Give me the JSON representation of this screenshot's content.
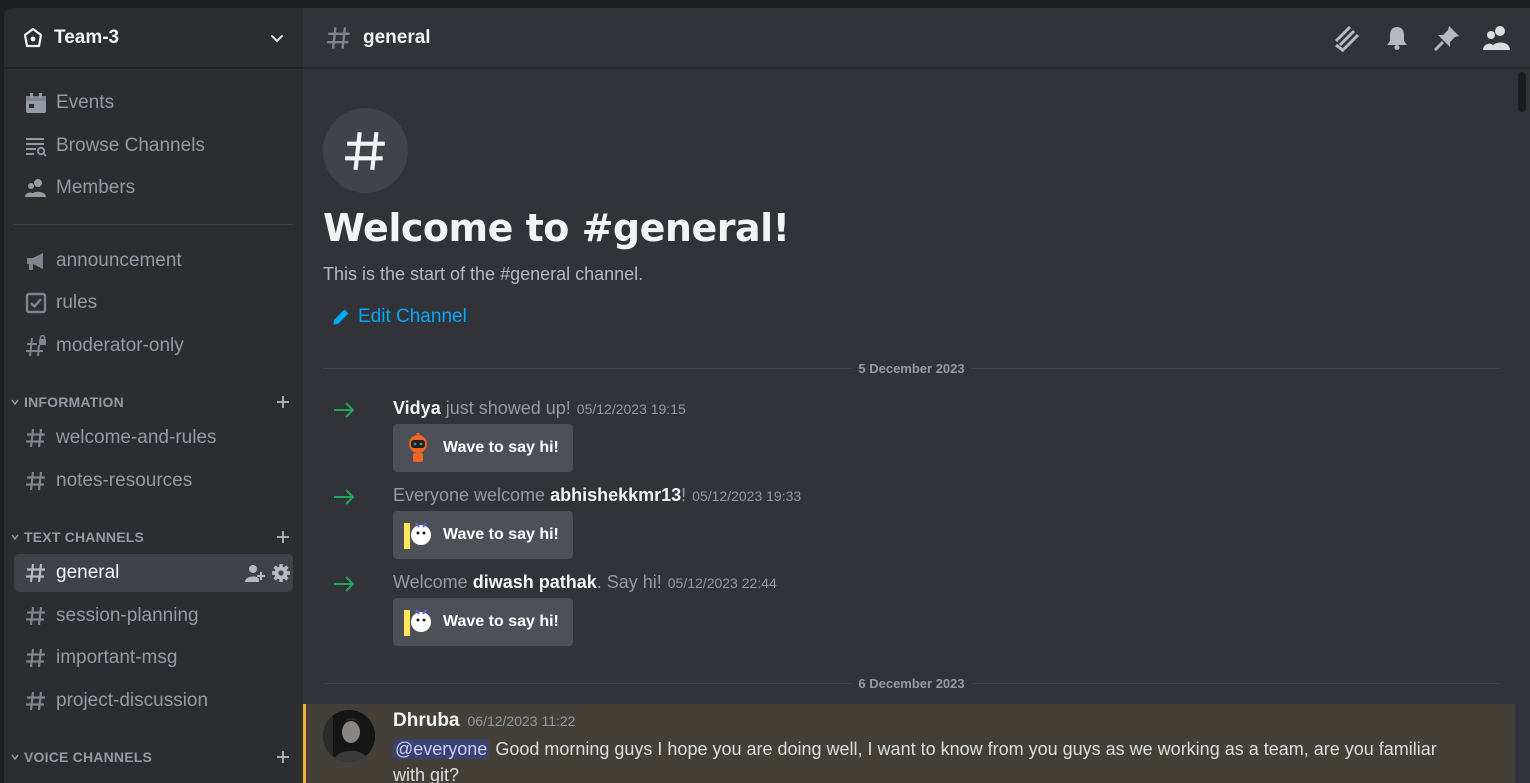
{
  "server": {
    "name": "Team-3",
    "icon": "server-home-icon"
  },
  "nav": [
    {
      "label": "Events",
      "icon": "calendar-icon"
    },
    {
      "label": "Browse Channels",
      "icon": "browse-channels-icon"
    },
    {
      "label": "Members",
      "icon": "members-icon"
    }
  ],
  "top_channels": [
    {
      "label": "announcement",
      "icon": "megaphone-icon"
    },
    {
      "label": "rules",
      "icon": "checkbox-icon"
    },
    {
      "label": "moderator-only",
      "icon": "locked-hash-icon"
    }
  ],
  "categories": {
    "information": {
      "label": "INFORMATION",
      "channels": [
        "welcome-and-rules",
        "notes-resources"
      ]
    },
    "text": {
      "label": "TEXT CHANNELS",
      "channels": [
        "general",
        "session-planning",
        "important-msg",
        "project-discussion"
      ]
    },
    "voice": {
      "label": "VOICE CHANNELS"
    }
  },
  "channel": {
    "name": "general"
  },
  "toolbar": [
    "threads-icon",
    "notification-bell-icon",
    "pin-icon",
    "member-list-icon"
  ],
  "welcome": {
    "title": "Welcome to #general!",
    "subtitle": "This is the start of the #general channel.",
    "edit_label": "Edit Channel"
  },
  "dates": [
    "5 December 2023",
    "6 December 2023"
  ],
  "system_messages": [
    {
      "pre": "",
      "name": "Vidya",
      "post": " just showed up!",
      "timestamp": "05/12/2023 19:15",
      "button": "Wave to say hi!"
    },
    {
      "pre": "Everyone welcome ",
      "name": "abhishekkmr13",
      "post": "!",
      "timestamp": "05/12/2023 19:33",
      "button": "Wave to say hi!"
    },
    {
      "pre": "Welcome ",
      "name": "diwash pathak",
      "post": ". Say hi!",
      "timestamp": "05/12/2023 22:44",
      "button": "Wave to say hi!"
    }
  ],
  "message": {
    "author": "Dhruba",
    "timestamp": "06/12/2023 11:22",
    "mention": "@everyone",
    "text": "Good morning guys I hope you are doing well, I want to know from you guys as we working as a team, are you familiar with git?"
  },
  "colors": {
    "accent_link": "#00a8fc",
    "join_arrow": "#23a55a",
    "mention_highlight": "#f0b232"
  }
}
